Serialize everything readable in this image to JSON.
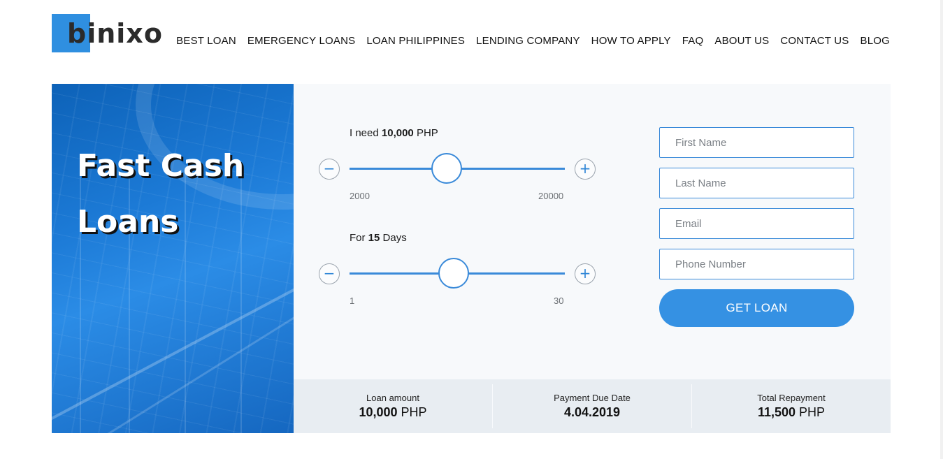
{
  "brand": {
    "logo_text": "binixo",
    "accent": "#2f8fe0"
  },
  "nav": {
    "items": [
      "BEST LOAN",
      "EMERGENCY LOANS",
      "LOAN PHILIPPINES",
      "LENDING COMPANY",
      "HOW TO APPLY",
      "FAQ",
      "ABOUT US",
      "CONTACT US",
      "BLOG"
    ]
  },
  "hero": {
    "title_line1": "Fast Cash",
    "title_line2": "Loans"
  },
  "amount_slider": {
    "prefix": "I need",
    "value": "10,000",
    "unit": "PHP",
    "min": "2000",
    "max": "20000",
    "minus_icon": "minus-icon",
    "plus_icon": "plus-icon",
    "minus_glyph": "−",
    "plus_glyph": "+"
  },
  "days_slider": {
    "prefix": "For",
    "value": "15",
    "unit": "Days",
    "min": "1",
    "max": "30",
    "minus_glyph": "−",
    "plus_glyph": "+"
  },
  "form": {
    "first_name_placeholder": "First Name",
    "last_name_placeholder": "Last Name",
    "email_placeholder": "Email",
    "phone_placeholder": "Phone Number",
    "submit_label": "GET LOAN",
    "button_color": "#3591e3"
  },
  "summary": {
    "loan_amount_label": "Loan amount",
    "loan_amount_value": "10,000",
    "loan_amount_unit": "PHP",
    "due_date_label": "Payment Due Date",
    "due_date_value": "4.04.2019",
    "total_label": "Total Repayment",
    "total_value": "11,500",
    "total_unit": "PHP"
  }
}
